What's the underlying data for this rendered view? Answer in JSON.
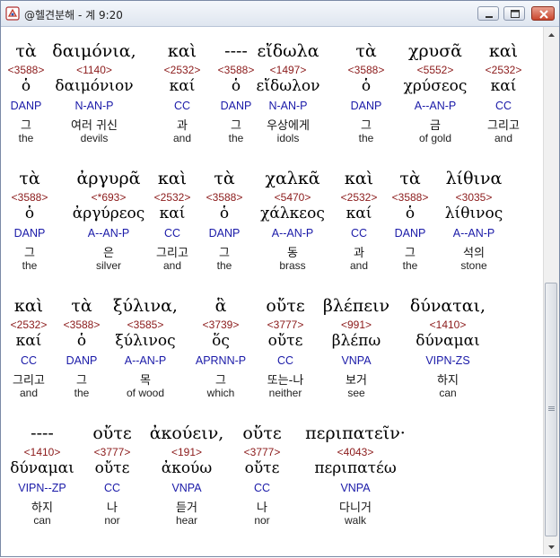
{
  "window": {
    "title": "@헬견분해 - 계 9:20",
    "icon": "app-book-icon",
    "buttons": [
      "minimize-icon",
      "maximize-icon",
      "close-icon"
    ]
  },
  "rows": [
    {
      "words": [
        {
          "greek": "τὰ",
          "num": "<3588>",
          "lemma": "ὁ",
          "parse": "DANP",
          "ko": "그",
          "en": "the"
        },
        {
          "greek": "δαιμόνια,",
          "num": "<1140>",
          "lemma": "δαιμόνιον",
          "parse": "N-AN-P",
          "ko": "여러 귀신",
          "en": "devils"
        },
        {
          "greek": "καὶ",
          "num": "<2532>",
          "lemma": "καί",
          "parse": "CC",
          "ko": "과",
          "en": "and"
        },
        {
          "greek": "----",
          "num": "<3588>",
          "lemma": "ὁ",
          "parse": "DANP",
          "ko": "그",
          "en": "the"
        },
        {
          "greek": "εἴδωλα",
          "num": "<1497>",
          "lemma": "εἴδωλον",
          "parse": "N-AN-P",
          "ko": "우상에게",
          "en": "idols"
        },
        {
          "greek": "τὰ",
          "num": "<3588>",
          "lemma": "ὁ",
          "parse": "DANP",
          "ko": "그",
          "en": "the"
        },
        {
          "greek": "χρυσᾶ",
          "num": "<5552>",
          "lemma": "χρύσεος",
          "parse": "A--AN-P",
          "ko": "금",
          "en": "of gold"
        },
        {
          "greek": "καὶ",
          "num": "<2532>",
          "lemma": "καί",
          "parse": "CC",
          "ko": "그리고",
          "en": "and"
        }
      ]
    },
    {
      "words": [
        {
          "greek": "τὰ",
          "num": "<3588>",
          "lemma": "ὁ",
          "parse": "DANP",
          "ko": "그",
          "en": "the"
        },
        {
          "greek": "ἀργυρᾶ",
          "num": "<*693>",
          "lemma": "ἀργύρεος",
          "parse": "A--AN-P",
          "ko": "은",
          "en": "silver"
        },
        {
          "greek": "καὶ",
          "num": "<2532>",
          "lemma": "καί",
          "parse": "CC",
          "ko": "그리고",
          "en": "and"
        },
        {
          "greek": "τὰ",
          "num": "<3588>",
          "lemma": "ὁ",
          "parse": "DANP",
          "ko": "그",
          "en": "the"
        },
        {
          "greek": "χαλκᾶ",
          "num": "<5470>",
          "lemma": "χάλκεος",
          "parse": "A--AN-P",
          "ko": "동",
          "en": "brass"
        },
        {
          "greek": "καὶ",
          "num": "<2532>",
          "lemma": "καί",
          "parse": "CC",
          "ko": "과",
          "en": "and"
        },
        {
          "greek": "τὰ",
          "num": "<3588>",
          "lemma": "ὁ",
          "parse": "DANP",
          "ko": "그",
          "en": "the"
        },
        {
          "greek": "λίθινα",
          "num": "<3035>",
          "lemma": "λίθινος",
          "parse": "A--AN-P",
          "ko": "석의",
          "en": "stone"
        }
      ]
    },
    {
      "words": [
        {
          "greek": "καὶ",
          "num": "<2532>",
          "lemma": "καί",
          "parse": "CC",
          "ko": "그리고",
          "en": "and"
        },
        {
          "greek": "τὰ",
          "num": "<3588>",
          "lemma": "ὁ",
          "parse": "DANP",
          "ko": "그",
          "en": "the"
        },
        {
          "greek": "ξύλινα,",
          "num": "<3585>",
          "lemma": "ξύλινος",
          "parse": "A--AN-P",
          "ko": "목",
          "en": "of wood"
        },
        {
          "greek": "ἃ",
          "num": "<3739>",
          "lemma": "ὅς",
          "parse": "APRNN-P",
          "ko": "그",
          "en": "which"
        },
        {
          "greek": "οὔτε",
          "num": "<3777>",
          "lemma": "οὔτε",
          "parse": "CC",
          "ko": "또는-나",
          "en": "neither"
        },
        {
          "greek": "βλέπειν",
          "num": "<991>",
          "lemma": "βλέπω",
          "parse": "VNPA",
          "ko": "보거",
          "en": "see"
        },
        {
          "greek": "δύναται,",
          "num": "<1410>",
          "lemma": "δύναμαι",
          "parse": "VIPN-ZS",
          "ko": "하지",
          "en": "can"
        }
      ]
    },
    {
      "words": [
        {
          "greek": "----",
          "num": "<1410>",
          "lemma": "δύναμαι",
          "parse": "VIPN--ZP",
          "ko": "하지",
          "en": "can"
        },
        {
          "greek": "οὔτε",
          "num": "<3777>",
          "lemma": "οὔτε",
          "parse": "CC",
          "ko": "나",
          "en": "nor"
        },
        {
          "greek": "ἀκούειν,",
          "num": "<191>",
          "lemma": "ἀκούω",
          "parse": "VNPA",
          "ko": "듣거",
          "en": "hear"
        },
        {
          "greek": "οὔτε",
          "num": "<3777>",
          "lemma": "οὔτε",
          "parse": "CC",
          "ko": "나",
          "en": "nor"
        },
        {
          "greek": "περιπατεῖν·",
          "num": "<4043>",
          "lemma": "περιπατέω",
          "parse": "VNPA",
          "ko": "다니거",
          "en": "walk"
        }
      ]
    }
  ]
}
